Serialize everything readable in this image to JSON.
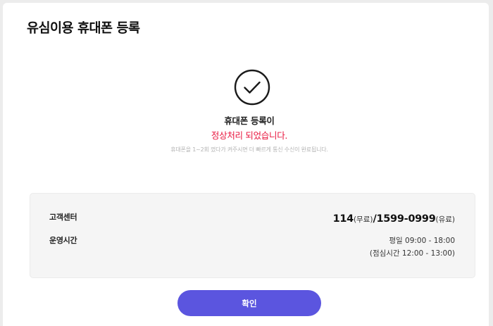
{
  "page": {
    "title": "유심이용 휴대폰 등록"
  },
  "result": {
    "icon": "check-circle-icon",
    "line1": "휴대폰 등록이",
    "line2": "정상처리 되었습니다.",
    "note": "휴대폰을 1~2회 껐다가 켜주시면 더 빠르게 통신 수신이 완료됩니다.",
    "accent_color": "#e8143c"
  },
  "support": {
    "center_label": "고객센터",
    "free_number": "114",
    "free_tag": "(무료)",
    "separator": "/",
    "paid_number": "1599-0999",
    "paid_tag": "(유료)",
    "hours_label": "운영시간",
    "hours_line1": "평일 09:00 - 18:00",
    "hours_line2": "(점심시간 12:00 - 13:00)"
  },
  "actions": {
    "confirm_label": "확인",
    "button_color": "#5b55df"
  }
}
